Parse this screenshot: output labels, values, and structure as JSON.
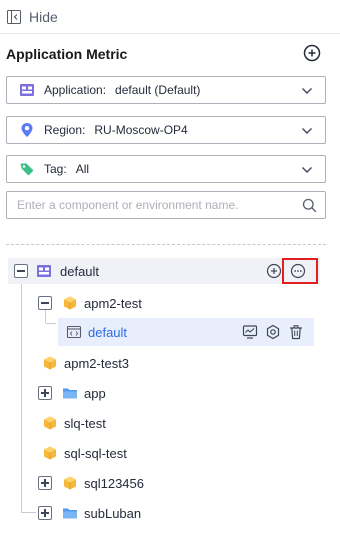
{
  "hide": {
    "label": "Hide"
  },
  "panel": {
    "title": "Application Metric"
  },
  "filters": [
    {
      "key": "Application:",
      "value": "default (Default)",
      "icon": "application-icon"
    },
    {
      "key": "Region:",
      "value": "RU-Moscow-OP4",
      "icon": "location-pin-icon"
    },
    {
      "key": "Tag:",
      "value": "All",
      "icon": "tag-icon"
    }
  ],
  "search": {
    "placeholder": "Enter a component or environment name."
  },
  "colors": {
    "accent": "#2e6ce6",
    "folder": "#4e9bf0",
    "cube": "#f5b83d",
    "highlight": "#e02020"
  },
  "tree": [
    {
      "label": "default",
      "icon": "application-icon",
      "expanded": true,
      "level": 0,
      "actions": [
        "add-circle-icon",
        "more-icon"
      ]
    },
    {
      "label": "apm2-test",
      "icon": "cube-icon",
      "expanded": true,
      "level": 1
    },
    {
      "label": "default",
      "icon": "environment-code-icon",
      "level": 2,
      "selected": true,
      "actions": [
        "monitor-icon",
        "settings-icon",
        "delete-icon"
      ]
    },
    {
      "label": "apm2-test3",
      "icon": "cube-icon",
      "level": 1
    },
    {
      "label": "app",
      "icon": "folder-icon",
      "expandable": true,
      "level": 1
    },
    {
      "label": "slq-test",
      "icon": "cube-icon",
      "level": 1
    },
    {
      "label": "sql-sql-test",
      "icon": "cube-icon",
      "level": 1
    },
    {
      "label": "sql123456",
      "icon": "cube-icon",
      "expandable": true,
      "level": 1
    },
    {
      "label": "subLuban",
      "icon": "folder-icon",
      "expandable": true,
      "level": 1
    }
  ]
}
